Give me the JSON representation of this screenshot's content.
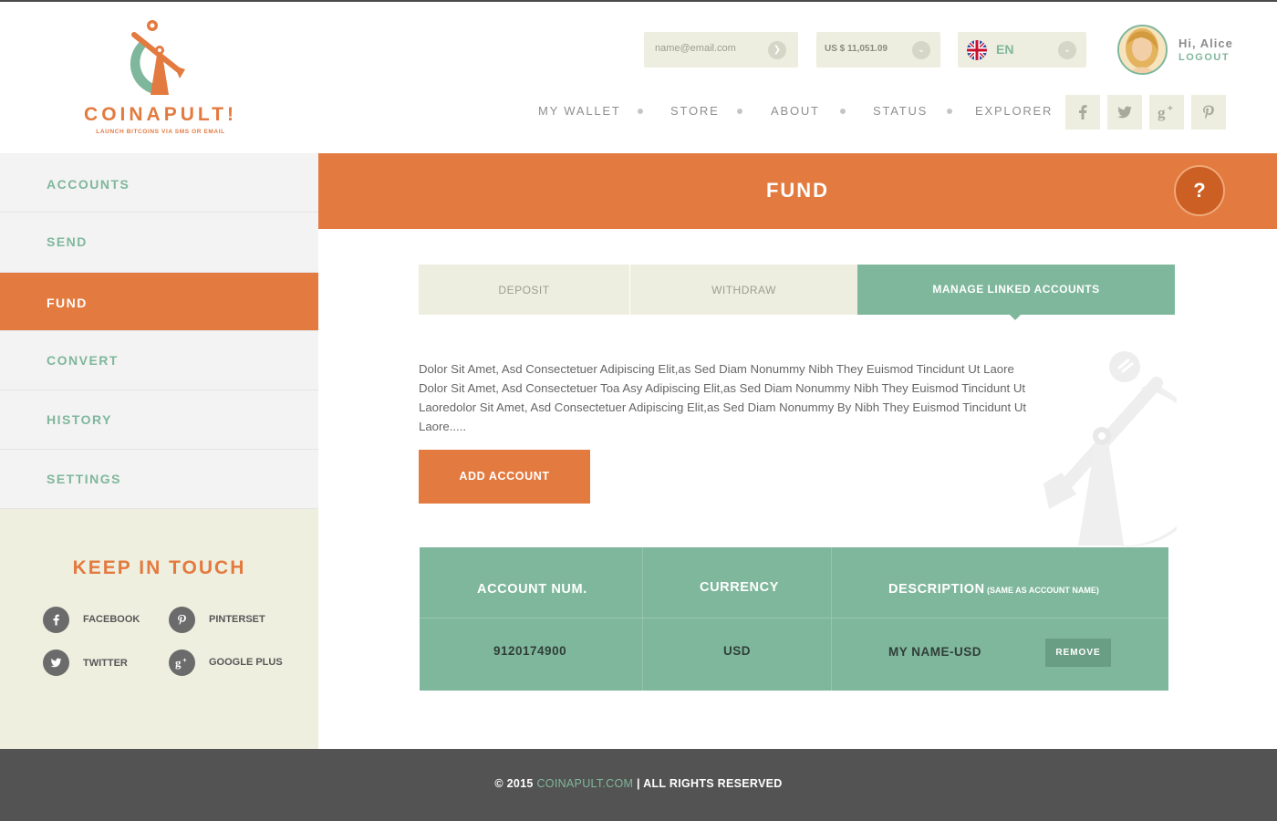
{
  "brand": {
    "name": "COINAPULT!",
    "tagline": "LAUNCH BITCOINS VIA SMS OR EMAIL"
  },
  "header": {
    "email_placeholder": "name@email.com",
    "balance": "US $ 11,051.09",
    "language": "EN",
    "greeting": "Hi, Alice",
    "logout": "LOGOUT"
  },
  "nav": {
    "items": [
      "MY WALLET",
      "STORE",
      "ABOUT",
      "STATUS",
      "EXPLORER"
    ]
  },
  "sidebar": {
    "items": [
      "ACCOUNTS",
      "SEND",
      "FUND",
      "CONVERT",
      "HISTORY",
      "SETTINGS"
    ],
    "active": "FUND",
    "keep_in_touch": "KEEP IN TOUCH",
    "social": [
      "FACEBOOK",
      "PINTERSET",
      "TWITTER",
      "GOOGLE PLUS"
    ]
  },
  "main": {
    "title": "FUND",
    "help": "?",
    "tabs": [
      "DEPOSIT",
      "WITHDRAW",
      "MANAGE LINKED ACCOUNTS"
    ],
    "active_tab": "MANAGE LINKED ACCOUNTS",
    "description": "Dolor Sit Amet, Asd Consectetuer Adipiscing Elit,as Sed Diam Nonummy Nibh They Euismod Tincidunt Ut Laore Dolor Sit Amet, Asd Consectetuer Toa Asy Adipiscing Elit,as Sed Diam Nonummy Nibh They Euismod Tincidunt Ut Laoredolor Sit Amet, Asd Consectetuer Adipiscing Elit,as Sed Diam Nonummy By Nibh They Euismod Tincidunt Ut Laore.....",
    "add_button": "ADD ACCOUNT",
    "table": {
      "headers": [
        "ACCOUNT NUM.",
        "CURRENCY",
        "DESCRIPTION"
      ],
      "description_note": "(SAME AS ACCOUNT NAME)",
      "rows": [
        {
          "account": "9120174900",
          "currency": "USD",
          "description": "MY NAME-USD",
          "action": "REMOVE"
        }
      ]
    }
  },
  "footer": {
    "prefix": "© 2015",
    "link": "COINAPULT.COM",
    "suffix": "| ALL RIGHTS RESERVED"
  },
  "colors": {
    "orange": "#e37a3f",
    "green": "#7fb79c",
    "cream": "#eeeee0",
    "footer": "#535353"
  },
  "icons": {
    "brand": "catapult-logo",
    "submit": "chevron-right-icon",
    "dropdown": "chevron-down-icon",
    "flag": "uk-flag-icon",
    "social": [
      "facebook-icon",
      "twitter-icon",
      "google-plus-icon",
      "pinterest-icon"
    ]
  }
}
